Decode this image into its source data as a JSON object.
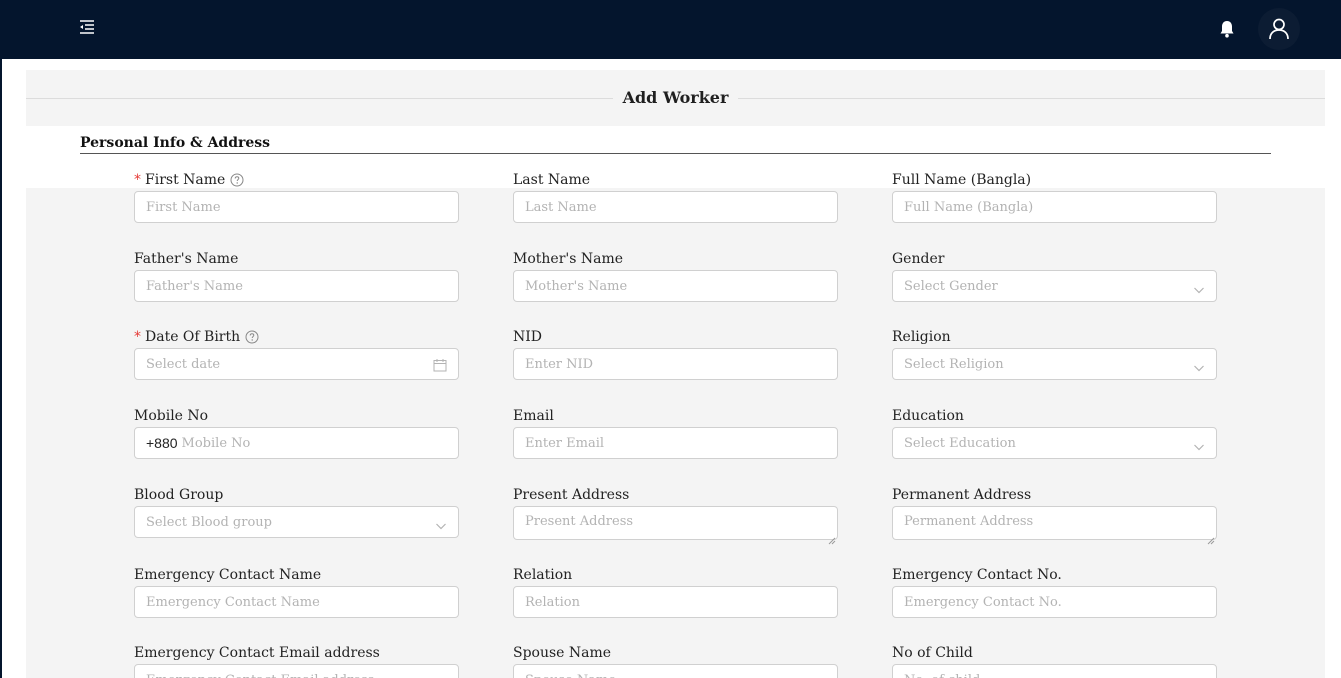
{
  "header": {
    "menu_icon": "menu-fold-icon",
    "bell_icon": "bell-icon",
    "user_icon": "user-icon"
  },
  "page": {
    "title": "Add Worker"
  },
  "section": {
    "title": "Personal Info & Address"
  },
  "fields": [
    {
      "label": "First Name",
      "placeholder": "First Name",
      "required": true,
      "help": true,
      "type": "text"
    },
    {
      "label": "Last Name",
      "placeholder": "Last Name",
      "type": "text"
    },
    {
      "label": "Full Name (Bangla)",
      "placeholder": "Full Name (Bangla)",
      "type": "text"
    },
    {
      "label": "Father's Name",
      "placeholder": "Father's Name",
      "type": "text"
    },
    {
      "label": "Mother's Name",
      "placeholder": "Mother's Name",
      "type": "text"
    },
    {
      "label": "Gender",
      "placeholder": "Select Gender",
      "type": "select"
    },
    {
      "label": "Date Of Birth",
      "placeholder": "Select date",
      "required": true,
      "help": true,
      "type": "date"
    },
    {
      "label": "NID",
      "placeholder": "Enter NID",
      "type": "text"
    },
    {
      "label": "Religion",
      "placeholder": "Select Religion",
      "type": "select"
    },
    {
      "label": "Mobile No",
      "placeholder": "Mobile No",
      "prefix": "+880",
      "type": "phone"
    },
    {
      "label": "Email",
      "placeholder": "Enter Email",
      "type": "text"
    },
    {
      "label": "Education",
      "placeholder": "Select Education",
      "type": "select"
    },
    {
      "label": "Blood Group",
      "placeholder": "Select Blood group",
      "type": "select"
    },
    {
      "label": "Present Address",
      "placeholder": "Present Address",
      "type": "textarea"
    },
    {
      "label": "Permanent Address",
      "placeholder": "Permanent Address",
      "type": "textarea"
    },
    {
      "label": "Emergency Contact Name",
      "placeholder": "Emergency Contact Name",
      "type": "text"
    },
    {
      "label": "Relation",
      "placeholder": "Relation",
      "type": "text"
    },
    {
      "label": "Emergency Contact No.",
      "placeholder": "Emergency Contact No.",
      "type": "text"
    },
    {
      "label": "Emergency Contact Email address",
      "placeholder": "Emergency Contact Email address",
      "type": "text"
    },
    {
      "label": "Spouse Name",
      "placeholder": "Spouse Name",
      "type": "text"
    },
    {
      "label": "No of Child",
      "placeholder": "No. of child",
      "type": "text"
    }
  ],
  "colors": {
    "header_bg": "#04152d",
    "required": "#e53935",
    "content_bg": "#f4f4f4"
  }
}
